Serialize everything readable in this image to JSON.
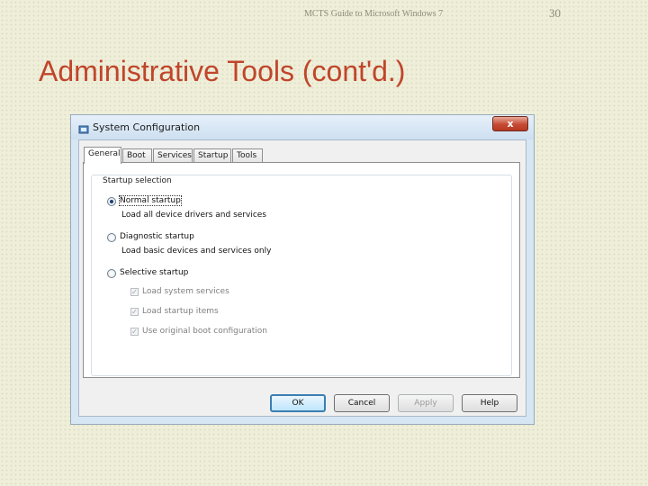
{
  "slide": {
    "header": "MCTS Guide to Microsoft Windows 7",
    "page_number": "30",
    "title": "Administrative Tools (cont'd.)"
  },
  "window": {
    "title": "System Configuration",
    "close_symbol": "x",
    "app_icon": "system-config-icon",
    "tabs": [
      {
        "label": "General",
        "active": true
      },
      {
        "label": "Boot",
        "active": false
      },
      {
        "label": "Services",
        "active": false
      },
      {
        "label": "Startup",
        "active": false
      },
      {
        "label": "Tools",
        "active": false
      }
    ],
    "group_label": "Startup selection",
    "options": [
      {
        "label": "Normal startup",
        "description": "Load all device drivers and services",
        "checked": true
      },
      {
        "label": "Diagnostic startup",
        "description": "Load basic devices and services only",
        "checked": false
      },
      {
        "label": "Selective startup",
        "description": "",
        "checked": false
      }
    ],
    "sub_options": [
      {
        "label": "Load system services",
        "checked": true,
        "enabled": false
      },
      {
        "label": "Load startup items",
        "checked": true,
        "enabled": false
      },
      {
        "label": "Use original boot configuration",
        "checked": true,
        "enabled": false
      }
    ],
    "buttons": {
      "ok": "OK",
      "cancel": "Cancel",
      "apply": "Apply",
      "help": "Help"
    },
    "colors": {
      "slide_title": "#c0452a",
      "close_button": "#c64a34"
    }
  }
}
